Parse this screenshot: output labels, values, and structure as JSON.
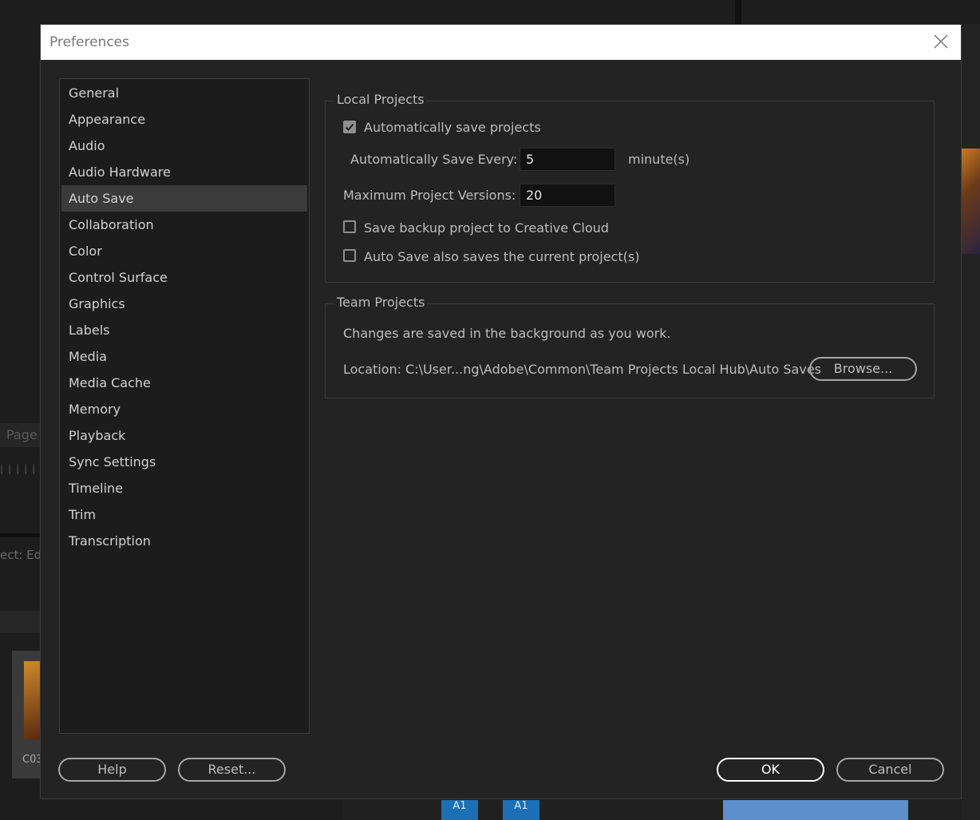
{
  "background": {
    "left_tab": "Page",
    "left_text": "ect: Edi",
    "clip_code": "C03",
    "track_a1": "A1"
  },
  "dialog": {
    "title": "Preferences",
    "close_icon": "close-icon"
  },
  "sidebar": {
    "items": [
      {
        "label": "General"
      },
      {
        "label": "Appearance"
      },
      {
        "label": "Audio"
      },
      {
        "label": "Audio Hardware"
      },
      {
        "label": "Auto Save",
        "selected": true
      },
      {
        "label": "Collaboration"
      },
      {
        "label": "Color"
      },
      {
        "label": "Control Surface"
      },
      {
        "label": "Graphics"
      },
      {
        "label": "Labels"
      },
      {
        "label": "Media"
      },
      {
        "label": "Media Cache"
      },
      {
        "label": "Memory"
      },
      {
        "label": "Playback"
      },
      {
        "label": "Sync Settings"
      },
      {
        "label": "Timeline"
      },
      {
        "label": "Trim"
      },
      {
        "label": "Transcription"
      }
    ]
  },
  "local_projects": {
    "legend": "Local Projects",
    "auto_save": {
      "label": "Automatically save projects",
      "checked": true
    },
    "save_every": {
      "label": "Automatically Save Every:",
      "value": "5",
      "unit": "minute(s)"
    },
    "max_versions": {
      "label": "Maximum Project Versions:",
      "value": "20"
    },
    "backup_cc": {
      "label": "Save backup project to Creative Cloud",
      "checked": false
    },
    "save_current": {
      "label": "Auto Save also saves the current project(s)",
      "checked": false
    }
  },
  "team_projects": {
    "legend": "Team Projects",
    "info": "Changes are saved in the background as you work.",
    "location_label": "Location:",
    "location_path": "C:\\User...ng\\Adobe\\Common\\Team Projects Local Hub\\Auto Saves",
    "browse_label": "Browse..."
  },
  "footer": {
    "help_label": "Help",
    "reset_label": "Reset...",
    "ok_label": "OK",
    "cancel_label": "Cancel"
  }
}
